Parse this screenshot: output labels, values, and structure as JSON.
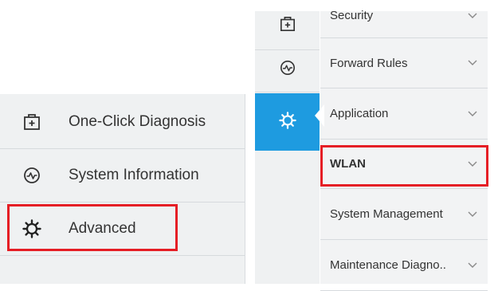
{
  "main_menu": {
    "items": [
      {
        "label": "One-Click Diagnosis",
        "icon": "diagnosis-icon"
      },
      {
        "label": "System Information",
        "icon": "system-information-icon"
      },
      {
        "label": "Advanced",
        "icon": "gear-icon"
      }
    ]
  },
  "icon_sidebar": {
    "items": [
      {
        "icon": "diagnosis-icon"
      },
      {
        "icon": "system-information-icon"
      },
      {
        "icon": "gear-icon",
        "active": true
      }
    ],
    "active_color": "#1e9be0"
  },
  "submenu": {
    "items": [
      {
        "label": "Security"
      },
      {
        "label": "Forward Rules"
      },
      {
        "label": "Application"
      },
      {
        "label": "WLAN"
      },
      {
        "label": "System Management"
      },
      {
        "label": "Maintenance Diagno.."
      }
    ]
  },
  "highlight_color": "#e51e25"
}
